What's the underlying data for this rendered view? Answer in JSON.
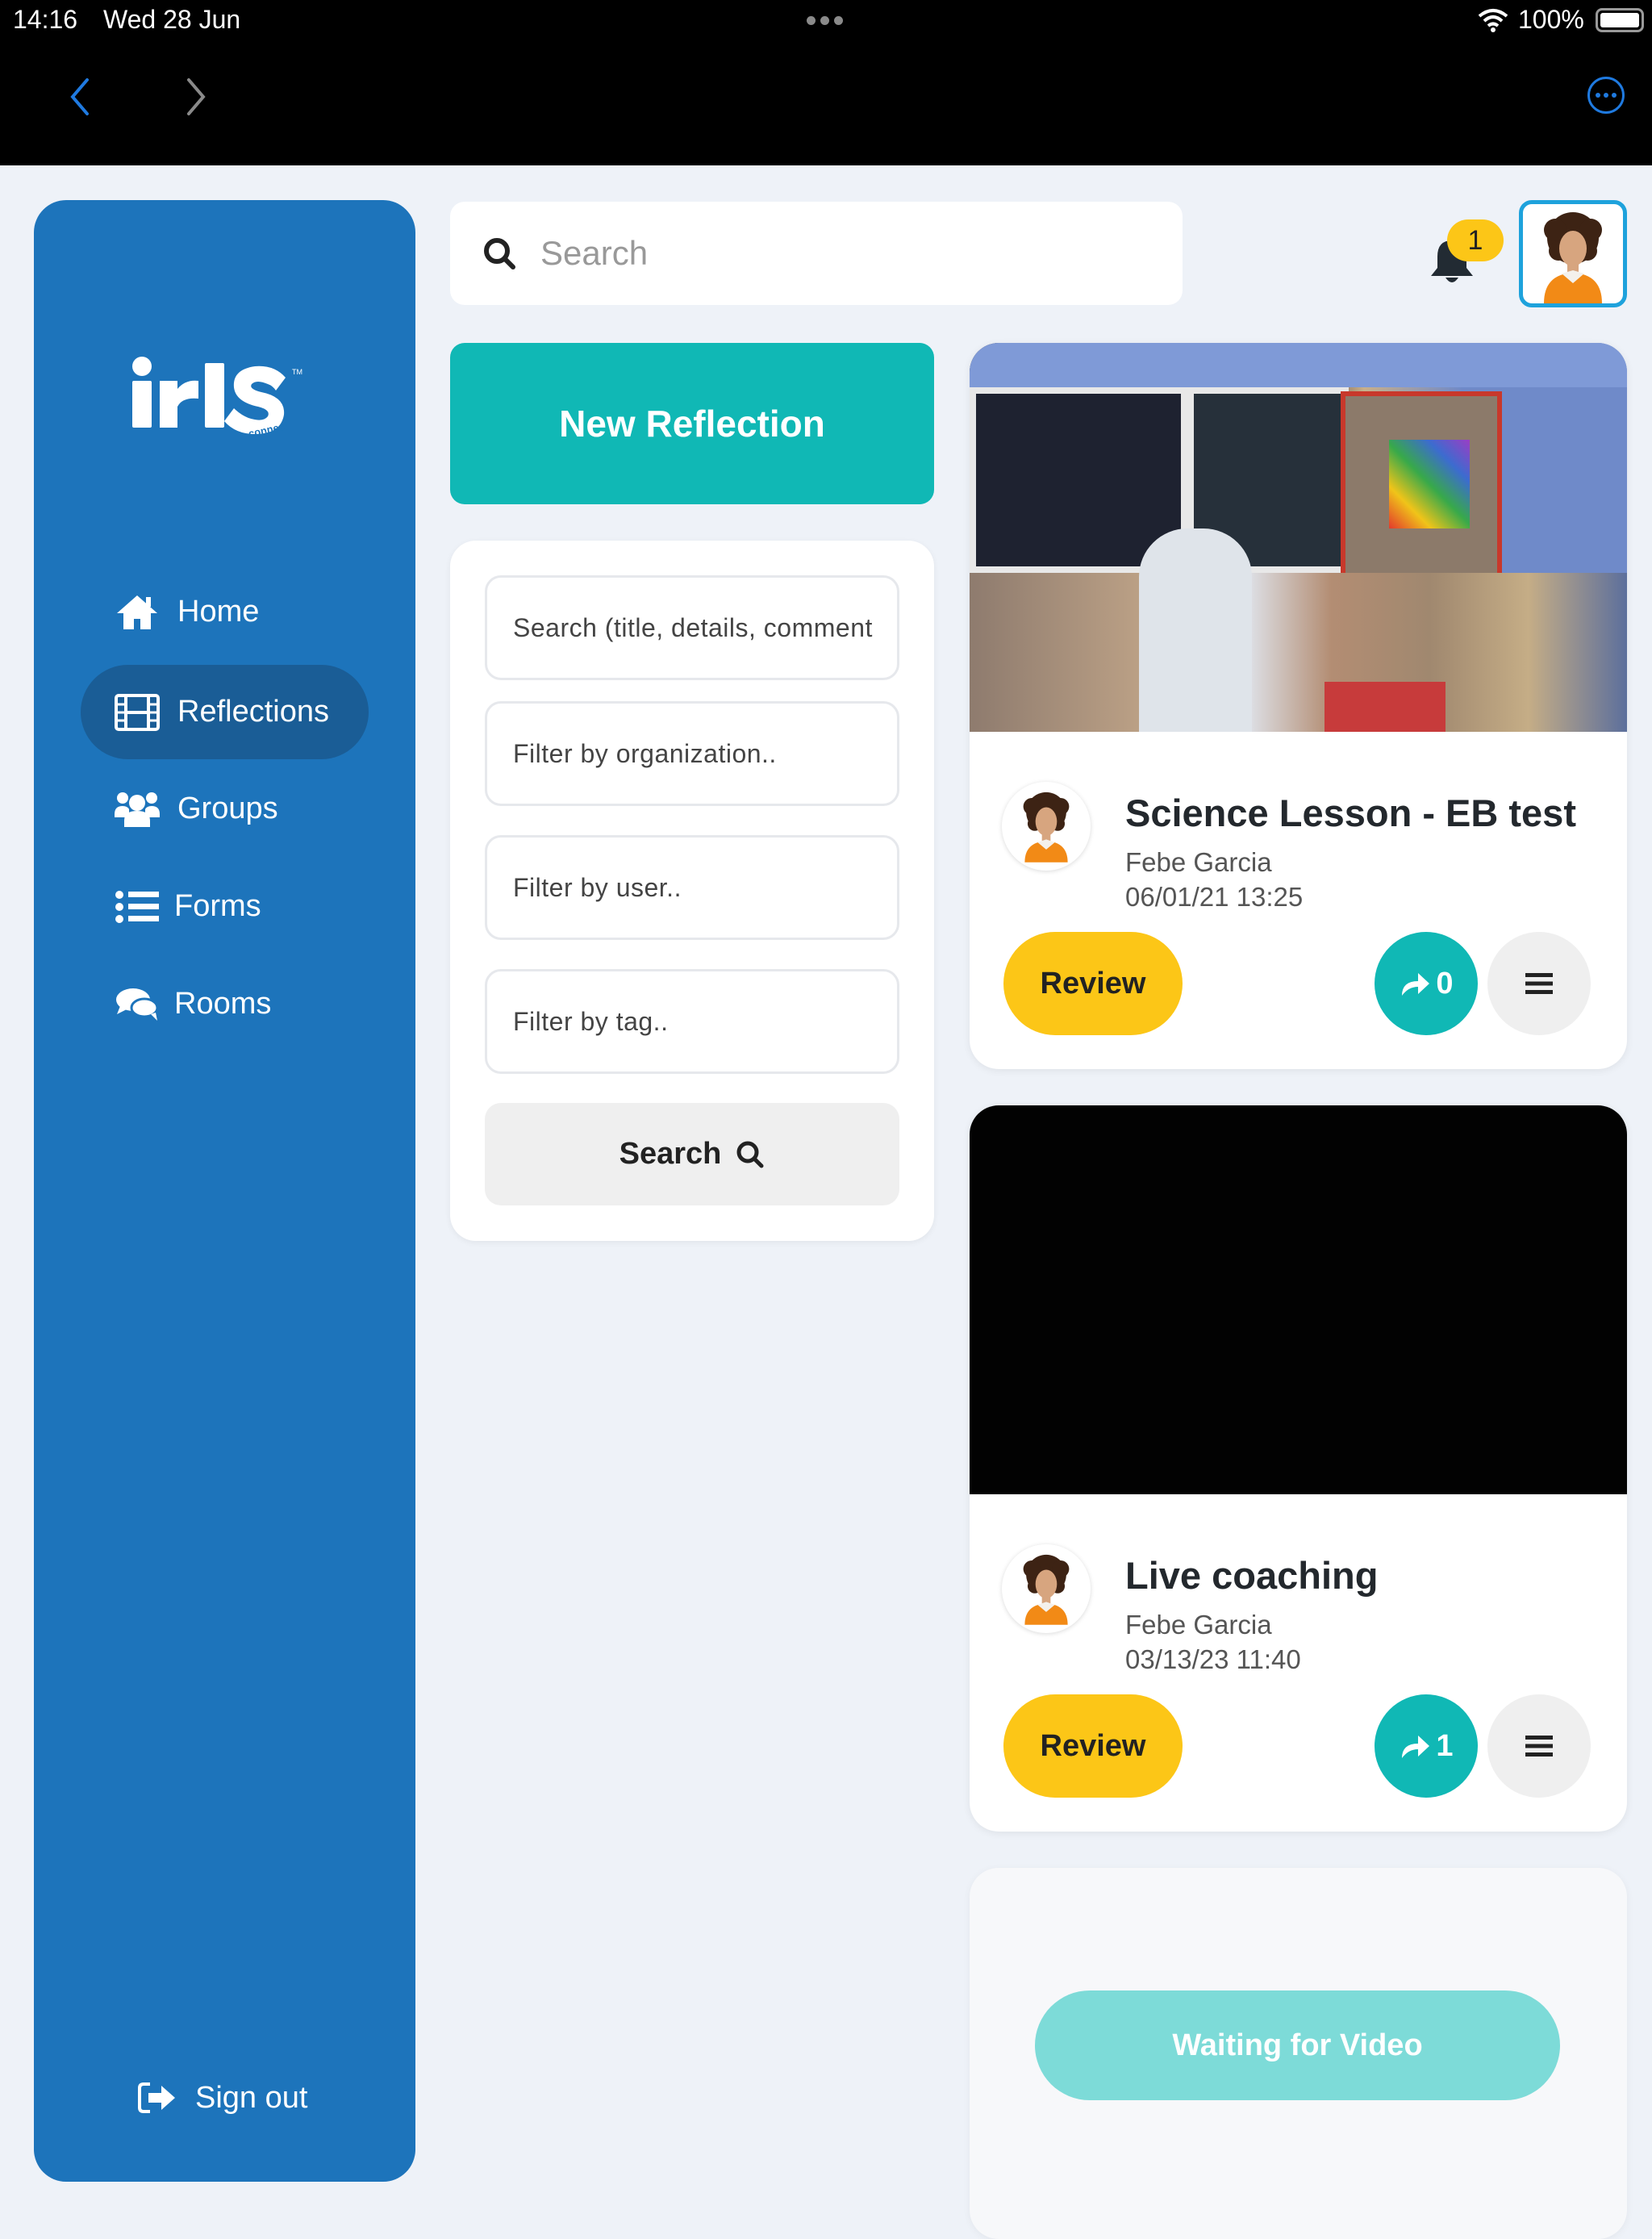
{
  "status_bar": {
    "time": "14:16",
    "date": "Wed 28 Jun",
    "battery": "100%"
  },
  "nav_bar": {
    "back_icon": "chevron-left-icon",
    "forward_icon": "chevron-right-icon",
    "more_icon": "ellipsis-circle-icon"
  },
  "sidebar": {
    "logo_text": "iris",
    "logo_sub": "connect",
    "items": [
      {
        "label": "Home",
        "icon": "home-icon",
        "active": false
      },
      {
        "label": "Reflections",
        "icon": "film-icon",
        "active": true
      },
      {
        "label": "Groups",
        "icon": "users-icon",
        "active": false
      },
      {
        "label": "Forms",
        "icon": "list-icon",
        "active": false
      },
      {
        "label": "Rooms",
        "icon": "comments-icon",
        "active": false
      }
    ],
    "signout_label": "Sign out"
  },
  "header": {
    "search_placeholder": "Search",
    "notification_count": "1"
  },
  "new_reflection_label": "New Reflection",
  "filters": {
    "search_placeholder": "Search (title, details, comment",
    "organization_placeholder": "Filter by organization..",
    "user_placeholder": "Filter by user..",
    "tag_placeholder": "Filter by tag..",
    "search_button": "Search"
  },
  "cards": [
    {
      "title": "Science Lesson - EB test",
      "author": "Febe Garcia",
      "date": "06/01/21 13:25",
      "review_label": "Review",
      "share_count": "0",
      "thumbnail": "classroom-photo"
    },
    {
      "title": "Live coaching",
      "author": "Febe Garcia",
      "date": "03/13/23 11:40",
      "review_label": "Review",
      "share_count": "1",
      "thumbnail": "black-video"
    }
  ],
  "pending_card": {
    "button_label": "Waiting for Video"
  },
  "colors": {
    "sidebar": "#1d74bb",
    "sidebar_active": "#1a5d96",
    "teal": "#10b8b5",
    "yellow": "#fcc617",
    "background": "#eef2f8",
    "waiting": "#7ddbd8"
  }
}
